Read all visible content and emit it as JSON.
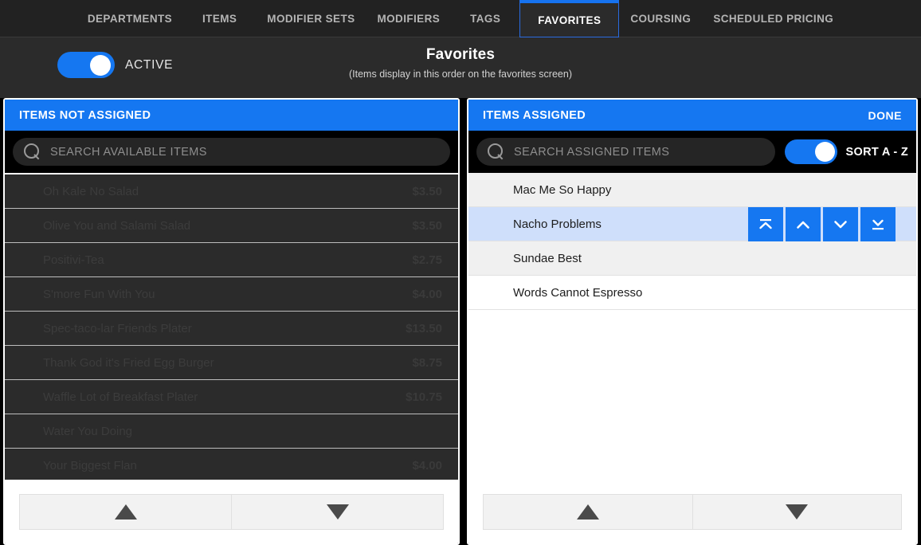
{
  "tabs": [
    {
      "label": "DEPARTMENTS",
      "active": false
    },
    {
      "label": "ITEMS",
      "active": false
    },
    {
      "label": "MODIFIER SETS",
      "active": false
    },
    {
      "label": "MODIFIERS",
      "active": false
    },
    {
      "label": "TAGS",
      "active": false
    },
    {
      "label": "FAVORITES",
      "active": true
    },
    {
      "label": "COURSING",
      "active": false
    },
    {
      "label": "SCHEDULED PRICING",
      "active": false
    }
  ],
  "header": {
    "active_toggle_label": "ACTIVE",
    "active_toggle_state": "on",
    "title": "Favorites",
    "subtitle": "(Items display in this order on the favorites screen)"
  },
  "left_panel": {
    "header_title": "ITEMS NOT ASSIGNED",
    "search_placeholder": "SEARCH AVAILABLE ITEMS",
    "search_value": "",
    "items": [
      {
        "name": "Oh Kale No Salad",
        "price": "$3.50"
      },
      {
        "name": "Olive You and Salami Salad",
        "price": "$3.50"
      },
      {
        "name": "Positivi-Tea",
        "price": "$2.75"
      },
      {
        "name": "S'more Fun With You",
        "price": "$4.00"
      },
      {
        "name": "Spec-taco-lar Friends Plater",
        "price": "$13.50"
      },
      {
        "name": "Thank God it's Fried Egg Burger",
        "price": "$8.75"
      },
      {
        "name": "Waffle Lot of Breakfast Plater",
        "price": "$10.75"
      },
      {
        "name": "Water You Doing",
        "price": ""
      },
      {
        "name": "Your Biggest Flan",
        "price": "$4.00"
      }
    ],
    "pager": {
      "up_icon": "triangle-up-icon",
      "down_icon": "triangle-down-icon"
    }
  },
  "right_panel": {
    "header_title": "ITEMS ASSIGNED",
    "done_label": "DONE",
    "search_placeholder": "SEARCH ASSIGNED ITEMS",
    "search_value": "",
    "sort_label": "SORT A - Z",
    "sort_toggle_state": "on",
    "items": [
      {
        "name": "Mac Me So Happy",
        "selected": false
      },
      {
        "name": "Nacho Problems",
        "selected": true
      },
      {
        "name": "Sundae Best",
        "selected": false
      },
      {
        "name": "Words Cannot Espresso",
        "selected": false
      }
    ],
    "move_buttons": [
      {
        "icon": "move-to-top-icon"
      },
      {
        "icon": "move-up-icon"
      },
      {
        "icon": "move-down-icon"
      },
      {
        "icon": "move-to-bottom-icon"
      }
    ],
    "pager": {
      "up_icon": "triangle-up-icon",
      "down_icon": "triangle-down-icon"
    }
  },
  "colors": {
    "accent_blue": "#1577f1",
    "tab_active_border": "#2a6ce0",
    "panel_bg_dark": "#2b2b2b",
    "selected_row": "#cfdffb",
    "page_bg": "#000000"
  }
}
